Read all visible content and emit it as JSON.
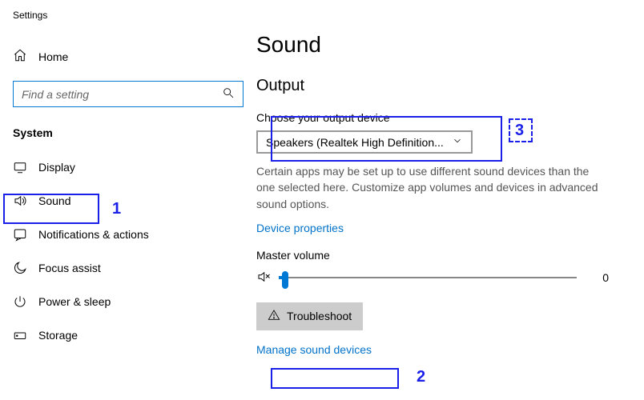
{
  "app_title": "Settings",
  "sidebar": {
    "home_label": "Home",
    "search_placeholder": "Find a setting",
    "section_title": "System",
    "items": [
      {
        "label": "Display"
      },
      {
        "label": "Sound"
      },
      {
        "label": "Notifications & actions"
      },
      {
        "label": "Focus assist"
      },
      {
        "label": "Power & sleep"
      },
      {
        "label": "Storage"
      }
    ]
  },
  "main": {
    "title": "Sound",
    "output": {
      "heading": "Output",
      "choose_label": "Choose your output device",
      "selected_device": "Speakers (Realtek High Definition...",
      "description": "Certain apps may be set up to use different sound devices than the one selected here. Customize app volumes and devices in advanced sound options.",
      "device_properties_link": "Device properties",
      "master_volume_label": "Master volume",
      "master_volume_value": "0",
      "troubleshoot_label": "Troubleshoot",
      "manage_link": "Manage sound devices"
    }
  },
  "annotations": {
    "n1": "1",
    "n2": "2",
    "n3": "3"
  }
}
